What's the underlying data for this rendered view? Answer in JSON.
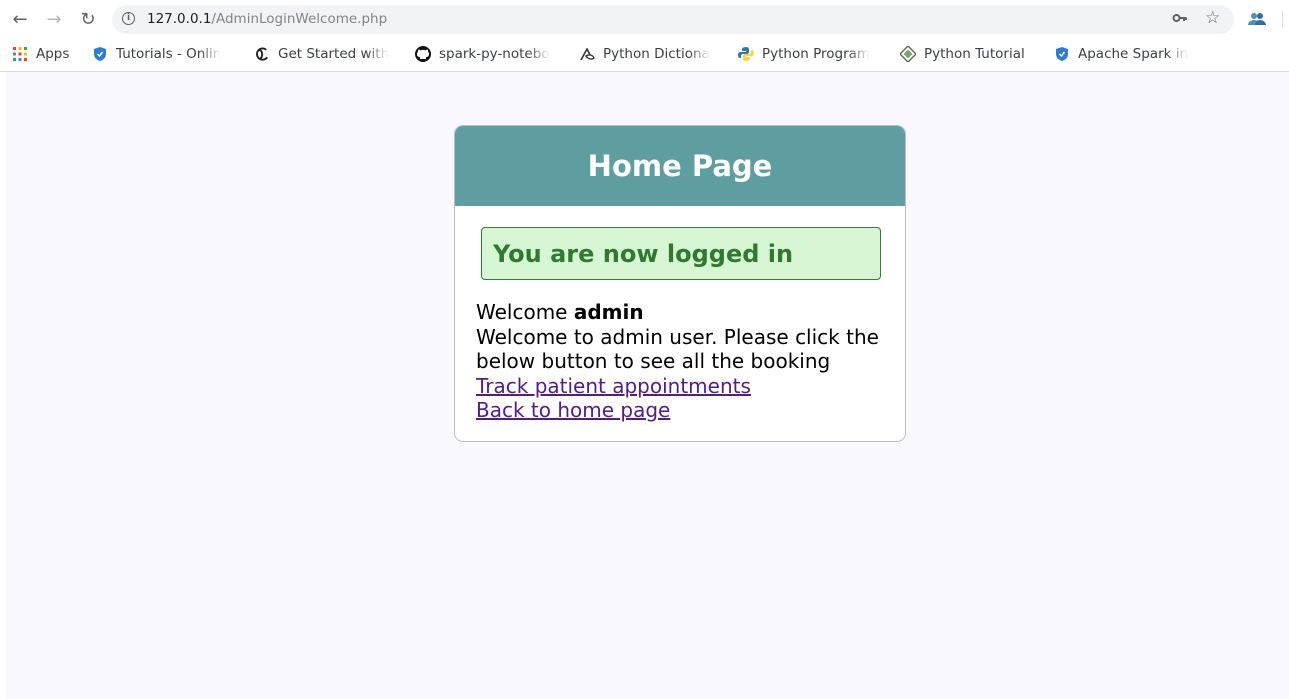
{
  "browser": {
    "url_host": "127.0.0.1",
    "url_path": "/AdminLoginWelcome.php",
    "bookmarks": [
      {
        "label": "Apps",
        "icon": "apps-grid-icon"
      },
      {
        "label": "Tutorials - Onlin",
        "icon": "shield-icon"
      },
      {
        "label": "Get Started with",
        "icon": "swirl-icon"
      },
      {
        "label": "spark-py-notebo",
        "icon": "github-icon"
      },
      {
        "label": "Python Dictiona",
        "icon": "python-dictionary-icon"
      },
      {
        "label": "Python Program",
        "icon": "python-logo-icon"
      },
      {
        "label": "Python Tutorial",
        "icon": "diamond-icon"
      },
      {
        "label": "Apache Spark in",
        "icon": "shield-icon"
      }
    ]
  },
  "card": {
    "title": "Home Page",
    "success_message": "You are now logged in",
    "welcome_prefix": "Welcome",
    "username": "admin",
    "description": "Welcome to admin user. Please click the below button to see all the booking",
    "link_track": "Track patient appointments",
    "link_home": "Back to home page"
  },
  "colors": {
    "header_bg": "#5f9ea0",
    "success_bg": "#d6f6d4",
    "success_text": "#2f7a2f",
    "link": "#551a8b",
    "page_bg": "#f8f8fe"
  }
}
